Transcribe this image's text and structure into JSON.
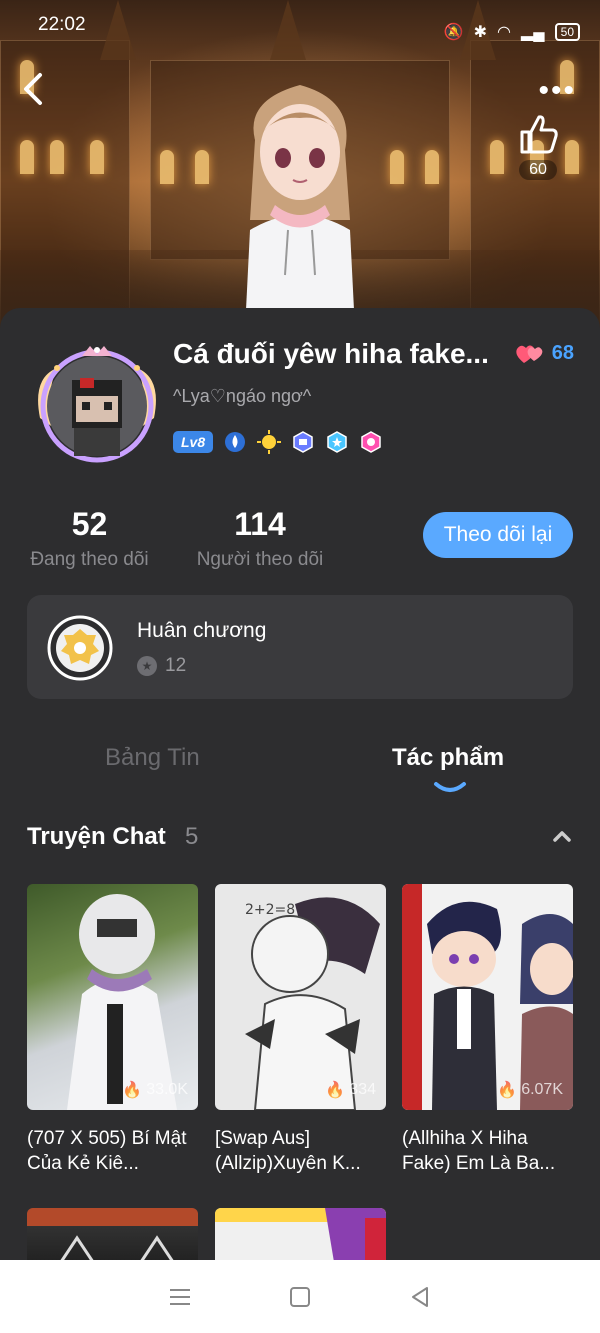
{
  "status": {
    "time": "22:02",
    "battery": "50"
  },
  "header": {
    "like_count": "60"
  },
  "profile": {
    "name": "Cá đuối yêw hiha fake...",
    "hearts": "68",
    "subname": "^Lya♡ngáo ngơ^",
    "level": "Lv8"
  },
  "stats": {
    "following_count": "52",
    "following_label": "Đang theo dõi",
    "followers_count": "114",
    "followers_label": "Người theo dõi",
    "follow_back_label": "Theo dõi lại"
  },
  "medals": {
    "title": "Huân chương",
    "count": "12"
  },
  "tabs": {
    "feed": "Bảng Tin",
    "works": "Tác phẩm"
  },
  "section": {
    "title": "Truyện Chat",
    "count": "5"
  },
  "stories": [
    {
      "views": "33.0K",
      "title": "(707 X 505) Bí Mật Của Kẻ Kiê..."
    },
    {
      "views": "334",
      "title": "[Swap Aus] (Allzip)Xuyên K..."
    },
    {
      "views": "6.07K",
      "title": "(Allhiha X Hiha Fake) Em Là Ba..."
    }
  ],
  "colors": {
    "accent": "#5aa9ff",
    "card_bg": "#2d2d2f",
    "panel_bg": "#3a3a3d",
    "heart": "#ff5a78"
  }
}
